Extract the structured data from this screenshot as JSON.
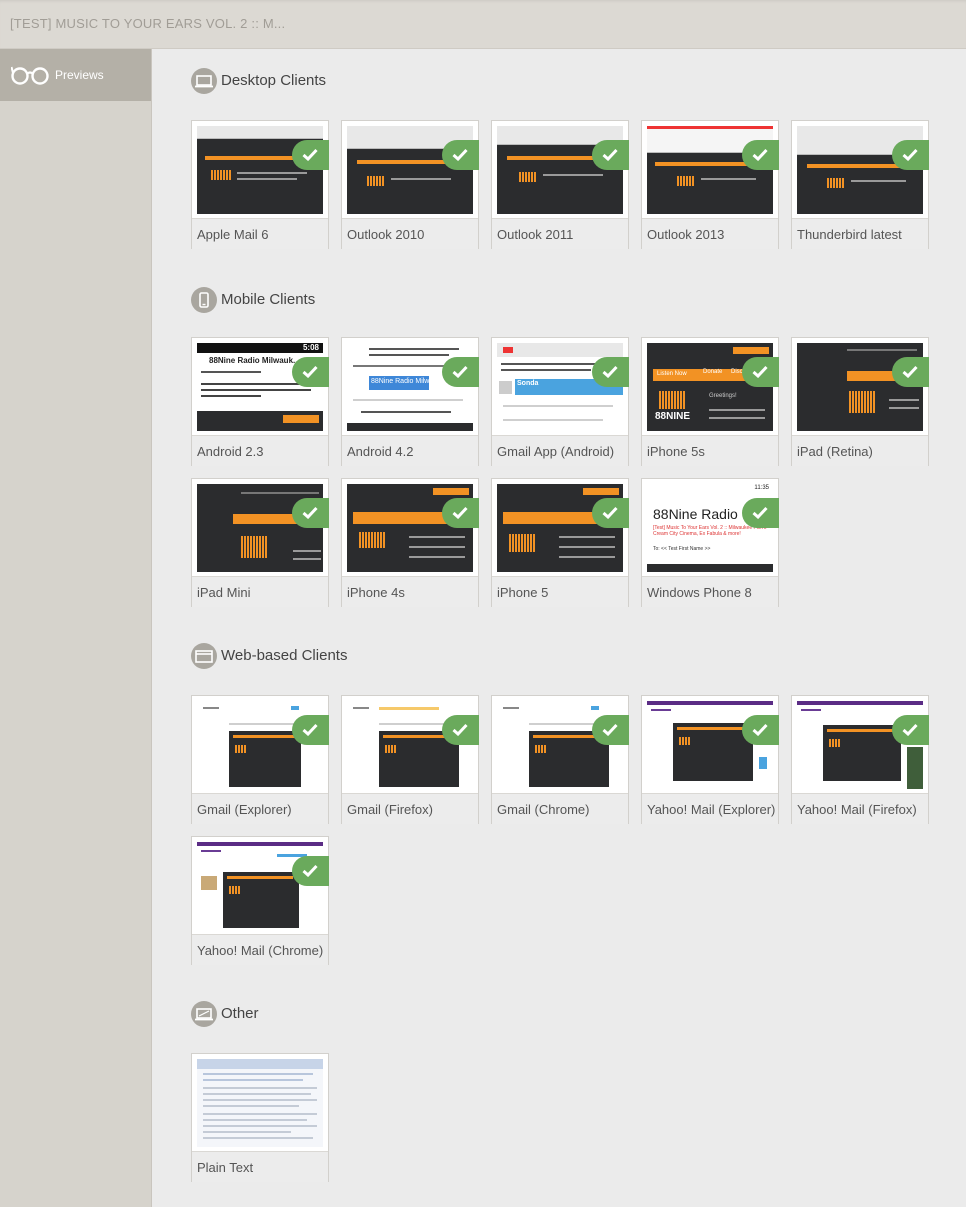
{
  "header": {
    "title": "[TEST] MUSIC TO YOUR EARS VOL. 2 :: M..."
  },
  "sidebar": {
    "items": [
      {
        "label": "Previews",
        "icon": "glasses-icon"
      }
    ]
  },
  "colors": {
    "check_green": "#6aaa5c",
    "accent_orange": "#f29224"
  },
  "sections": [
    {
      "title": "Desktop Clients",
      "icon": "desktop-icon",
      "clients": [
        {
          "label": "Apple Mail 6",
          "checked": true
        },
        {
          "label": "Outlook 2010",
          "checked": true
        },
        {
          "label": "Outlook 2011",
          "checked": true
        },
        {
          "label": "Outlook 2013",
          "checked": true
        },
        {
          "label": "Thunderbird latest",
          "checked": true
        }
      ]
    },
    {
      "title": "Mobile Clients",
      "icon": "mobile-icon",
      "clients": [
        {
          "label": "Android 2.3",
          "checked": true
        },
        {
          "label": "Android 4.2",
          "checked": true
        },
        {
          "label": "Gmail App (Android)",
          "checked": true
        },
        {
          "label": "iPhone 5s",
          "checked": true
        },
        {
          "label": "iPad (Retina)",
          "checked": true
        },
        {
          "label": "iPad Mini",
          "checked": true
        },
        {
          "label": "iPhone 4s",
          "checked": true
        },
        {
          "label": "iPhone 5",
          "checked": true
        },
        {
          "label": "Windows Phone 8",
          "checked": true
        }
      ]
    },
    {
      "title": "Web-based Clients",
      "icon": "browser-icon",
      "clients": [
        {
          "label": "Gmail (Explorer)",
          "checked": true
        },
        {
          "label": "Gmail (Firefox)",
          "checked": true
        },
        {
          "label": "Gmail (Chrome)",
          "checked": true
        },
        {
          "label": "Yahoo! Mail (Explorer)",
          "checked": true
        },
        {
          "label": "Yahoo! Mail (Firefox)",
          "checked": true
        },
        {
          "label": "Yahoo! Mail (Chrome)",
          "checked": true
        }
      ]
    },
    {
      "title": "Other",
      "icon": "plain-text-icon",
      "clients": [
        {
          "label": "Plain Text",
          "checked": false
        }
      ]
    }
  ],
  "thumb_text": {
    "android23_time": "5:08",
    "android23_sender": "88Nine Radio Milwauk...",
    "android42_sender": "88Nine Radio Milwau...",
    "gmail_sender": "Sonda",
    "ios_listen": "Listen Now",
    "ios_donate": "Donate",
    "ios_discover": "Discover",
    "ios_greeting": "Greetings!",
    "logo_88": "88NINE",
    "wp8_time": "11:35",
    "wp8_sender": "88Nine Radio",
    "wp8_subject": "[Test] Music To Your Ears Vol. 2 :: Milwaukee Film's Cream City Cinema, Ex Fabula & more!",
    "wp8_to": "To: << Test First Name >>"
  }
}
